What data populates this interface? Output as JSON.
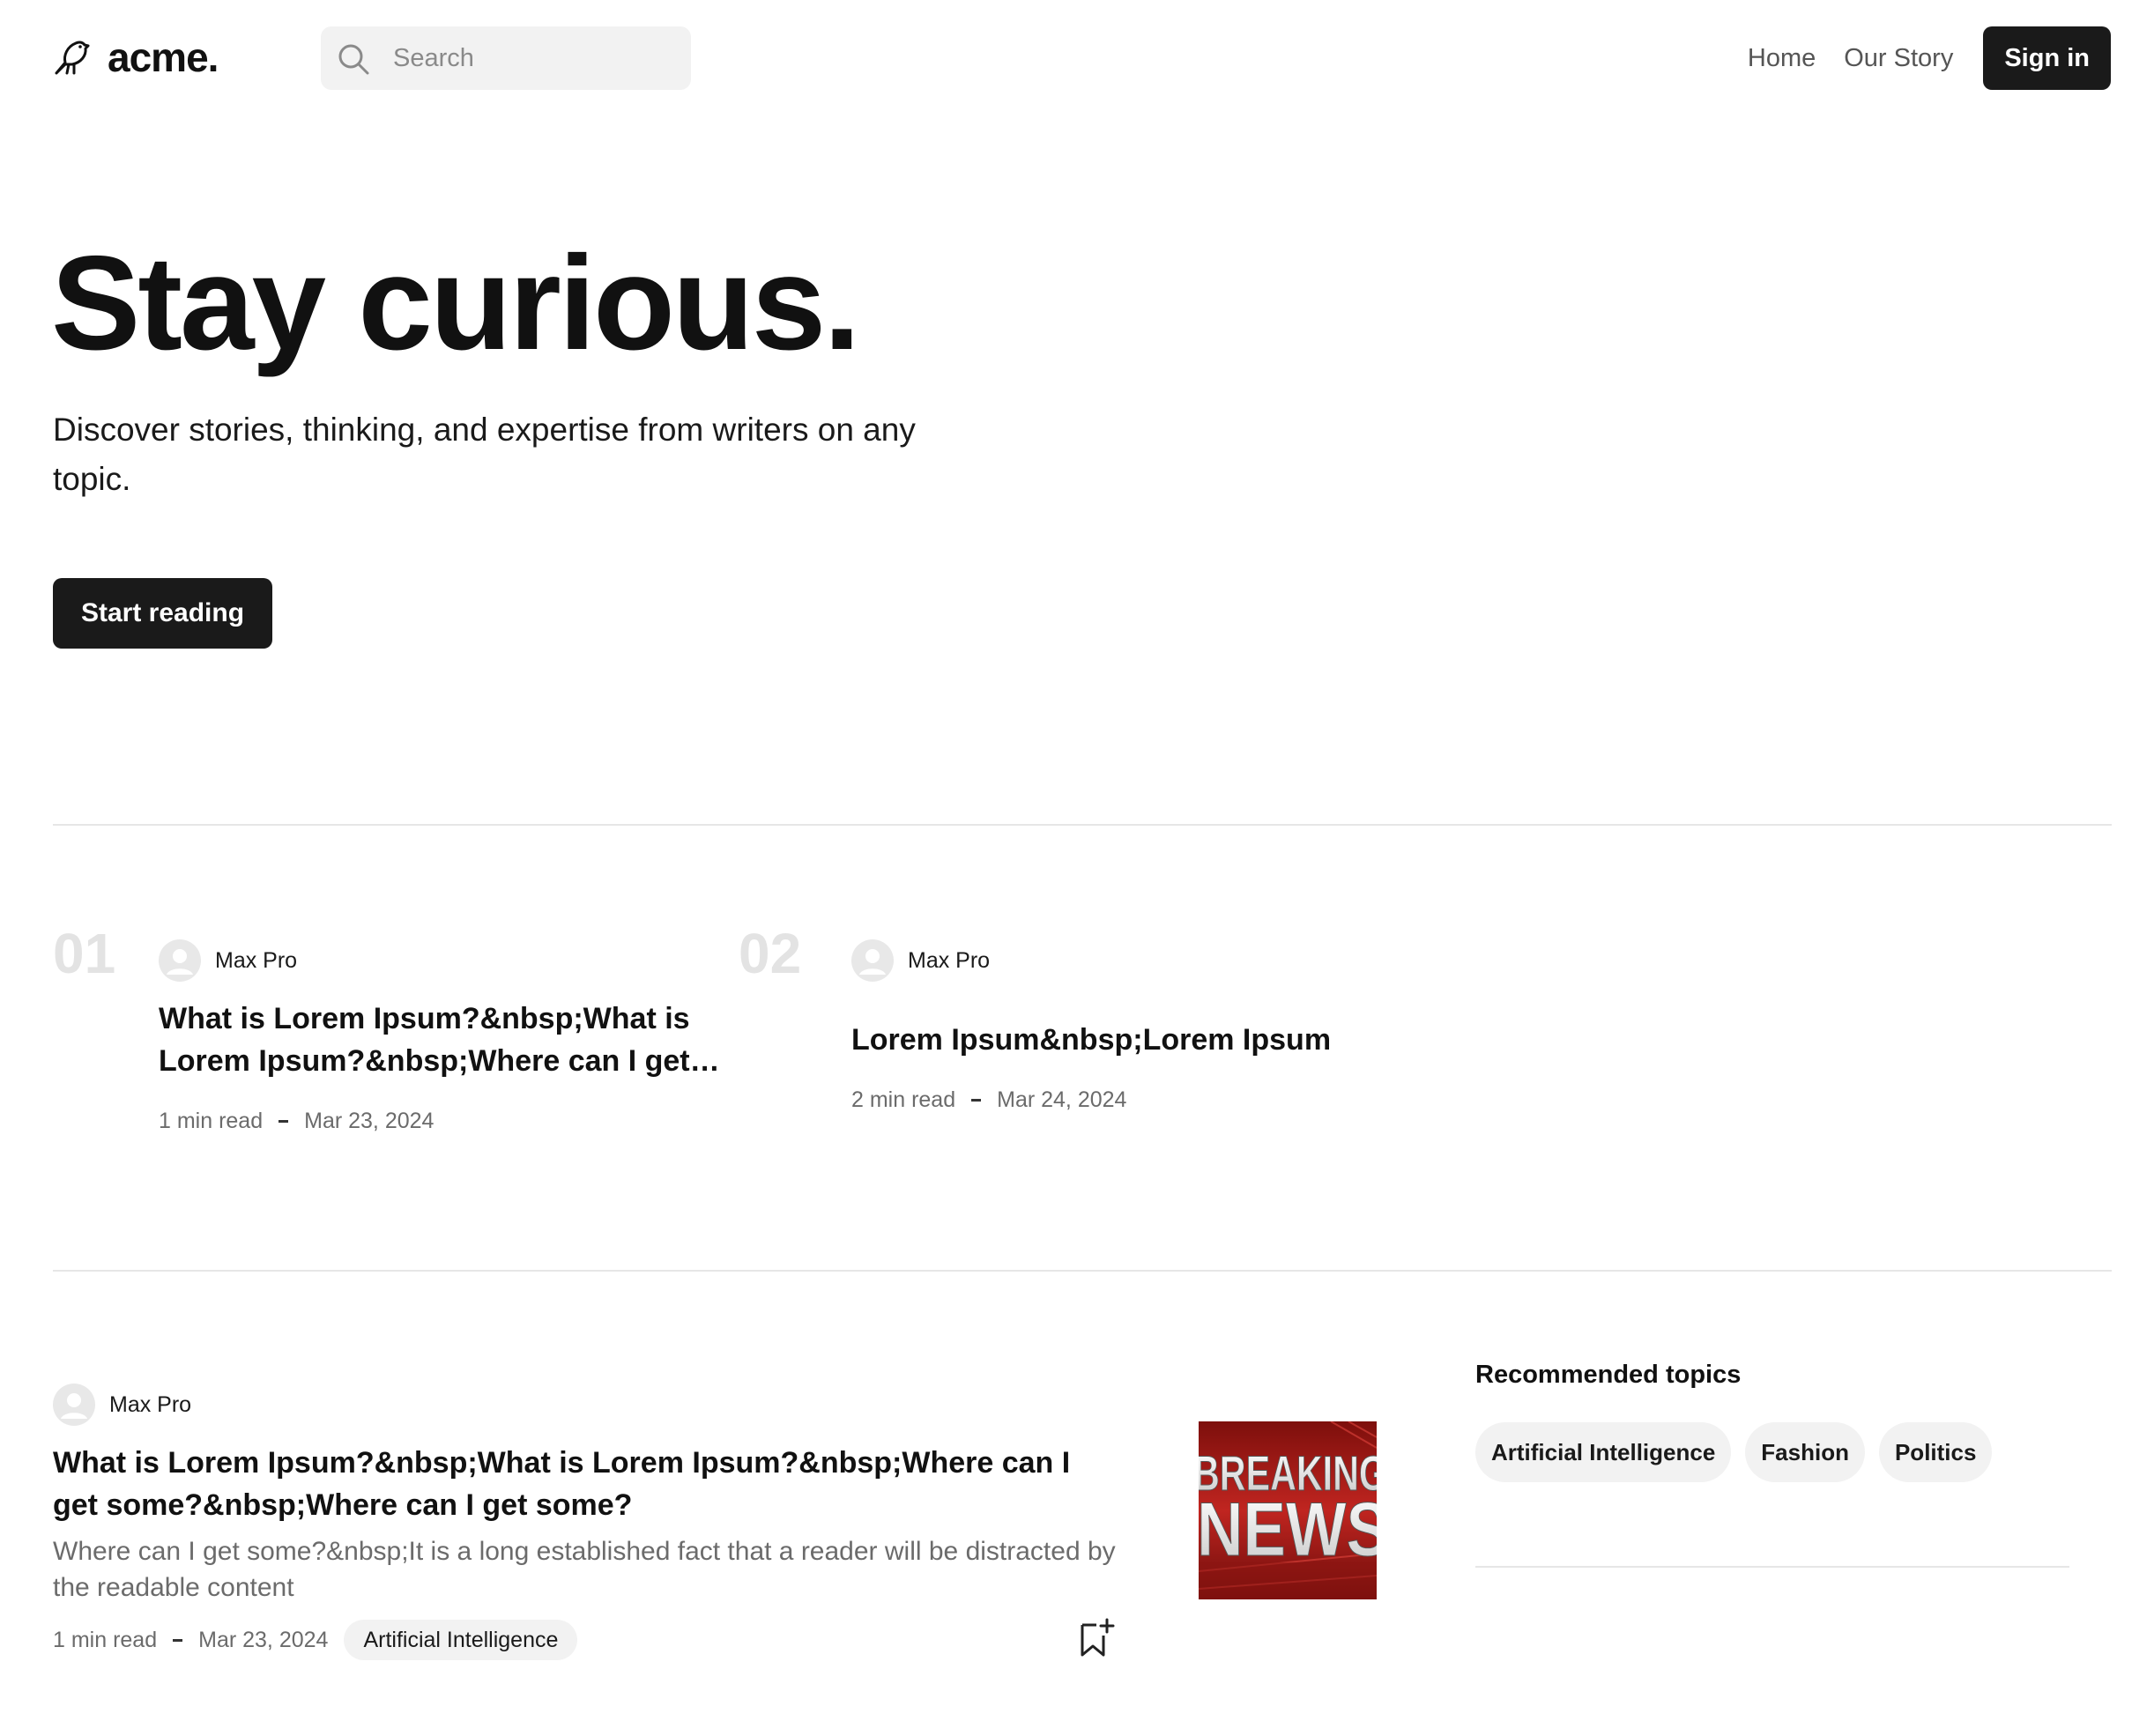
{
  "header": {
    "brand": "acme.",
    "search_placeholder": "Search",
    "nav": [
      {
        "label": "Home"
      },
      {
        "label": "Our Story"
      }
    ],
    "signin_label": "Sign in"
  },
  "hero": {
    "title": "Stay curious.",
    "subtitle": "Discover stories, thinking, and expertise from writers on any topic.",
    "cta_label": "Start reading"
  },
  "trending": [
    {
      "rank": "01",
      "author": "Max Pro",
      "title": "What is Lorem Ipsum?&nbsp;What is Lorem Ipsum?&nbsp;Where can I get some?&nbsp;Where can I get some?",
      "read_time": "1 min read",
      "date": "Mar 23, 2024"
    },
    {
      "rank": "02",
      "author": "Max Pro",
      "title": "Lorem Ipsum&nbsp;Lorem Ipsum",
      "read_time": "2 min read",
      "date": "Mar 24, 2024"
    }
  ],
  "feed": [
    {
      "author": "Max Pro",
      "title": "What is Lorem Ipsum?&nbsp;What is Lorem Ipsum?&nbsp;Where can I get some?&nbsp;Where can I get some?",
      "excerpt": "Where can I get some?&nbsp;It is a long established fact that a reader will be distracted by the readable content",
      "read_time": "1 min read",
      "date": "Mar 23, 2024",
      "tag": "Artificial Intelligence",
      "thumbnail": {
        "line1": "BREAKING",
        "line2": "NEWS"
      }
    }
  ],
  "sidebar": {
    "title": "Recommended topics",
    "topics": [
      {
        "label": "Artificial Intelligence"
      },
      {
        "label": "Fashion"
      },
      {
        "label": "Politics"
      }
    ]
  },
  "colors": {
    "primary_button": "#1a1a1a",
    "pill_bg": "#f2f2f2",
    "muted_text": "#6b6b6b",
    "rank_number": "#e3e3e3",
    "divider": "#e6e6e6",
    "thumbnail_red": "#b3201b"
  },
  "icons": {
    "logo": "bird-icon",
    "search": "search-icon",
    "avatar": "user-avatar-icon",
    "bookmark": "bookmark-add-icon"
  }
}
